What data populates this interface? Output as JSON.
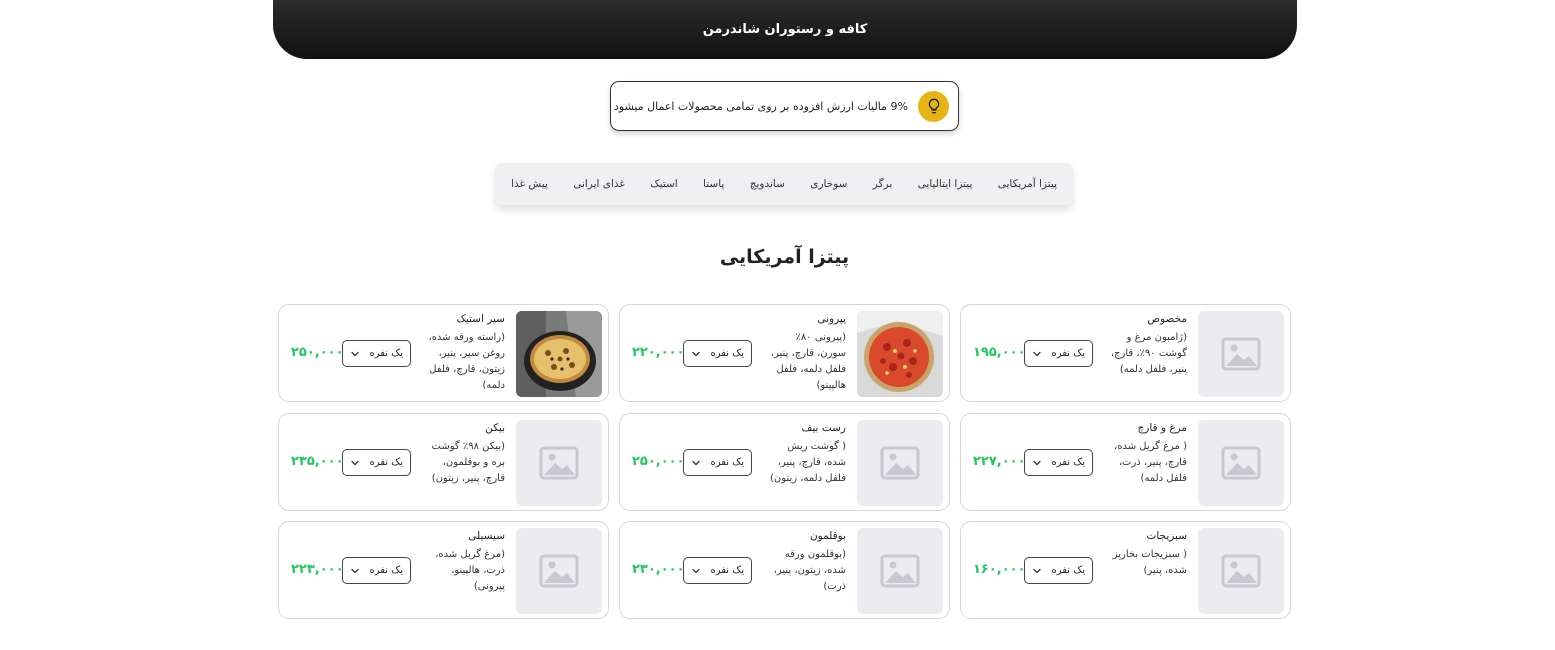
{
  "header": {
    "title": "کافه و رستوران شاندرمن"
  },
  "notice": {
    "text": "9% مالیات ارزش افزوده بر روی تمامی محصولات اعمال میشود",
    "icon": "lightbulb-icon",
    "icon_color": "#e7b416"
  },
  "categories": [
    "پیتزا آمریکایی",
    "پیتزا ایتالیایی",
    "برگر",
    "سوخاری",
    "ساندویچ",
    "پاستا",
    "استیک",
    "غذای ایرانی",
    "پیش غذا"
  ],
  "section": {
    "title": "پیتزا آمریکایی"
  },
  "colors": {
    "price": "#22c55e",
    "header_bg": "#1a1a1a",
    "category_bg": "#f0f0f3"
  },
  "items": [
    {
      "name": "مخصوص",
      "desc": "(ژامبون مرغ و گوشت ۹۰٪، قارچ، پنیر، فلفل دلمه)",
      "size": "یک نفره",
      "price": "۱۹۵,۰۰۰",
      "image": "placeholder"
    },
    {
      "name": "پپرونی",
      "desc": "(پپرونی ۸۰٪ سورن، قارچ، پنیر، فلفل دلمه، فلفل هالپینو)",
      "size": "یک نفره",
      "price": "۲۲۰,۰۰۰",
      "image": "pepperoni-pizza"
    },
    {
      "name": "سیر استیک",
      "desc": "(راسته ورقه شده، روغن سیر، پنیر، زیتون، قارچ، فلفل دلمه)",
      "size": "یک نفره",
      "price": "۲۵۰,۰۰۰",
      "image": "steak-pizza"
    },
    {
      "name": "مرغ و قارچ",
      "desc": "( مرغ گریل شده، قارچ، پنیر، ذرت، فلفل دلمه)",
      "size": "یک نفره",
      "price": "۲۲۷,۰۰۰",
      "image": "placeholder"
    },
    {
      "name": "رست بیف",
      "desc": "( گوشت ریش شده، قارچ، پنیر، فلفل دلمه، زیتون)",
      "size": "یک نفره",
      "price": "۲۵۰,۰۰۰",
      "image": "placeholder"
    },
    {
      "name": "بیکن",
      "desc": "(بیکن ۹۸٪ گوشت بره و بوقلمون، قارچ، پنیر، زیتون)",
      "size": "یک نفره",
      "price": "۲۳۵,۰۰۰",
      "image": "placeholder"
    },
    {
      "name": "سبزیجات",
      "desc": "( سبزیجات بخارپز شده، پنیر)",
      "size": "یک نفره",
      "price": "۱۶۰,۰۰۰",
      "image": "placeholder"
    },
    {
      "name": "بوقلمون",
      "desc": "(بوقلمون ورقه شده، زیتون، پنیر، ذرت)",
      "size": "یک نفره",
      "price": "۲۳۰,۰۰۰",
      "image": "placeholder"
    },
    {
      "name": "سیسیلی",
      "desc": "(مرغ گریل شده، ذرت، هالپینو، پپرونی)",
      "size": "یک نفره",
      "price": "۲۲۳,۰۰۰",
      "image": "placeholder"
    }
  ]
}
